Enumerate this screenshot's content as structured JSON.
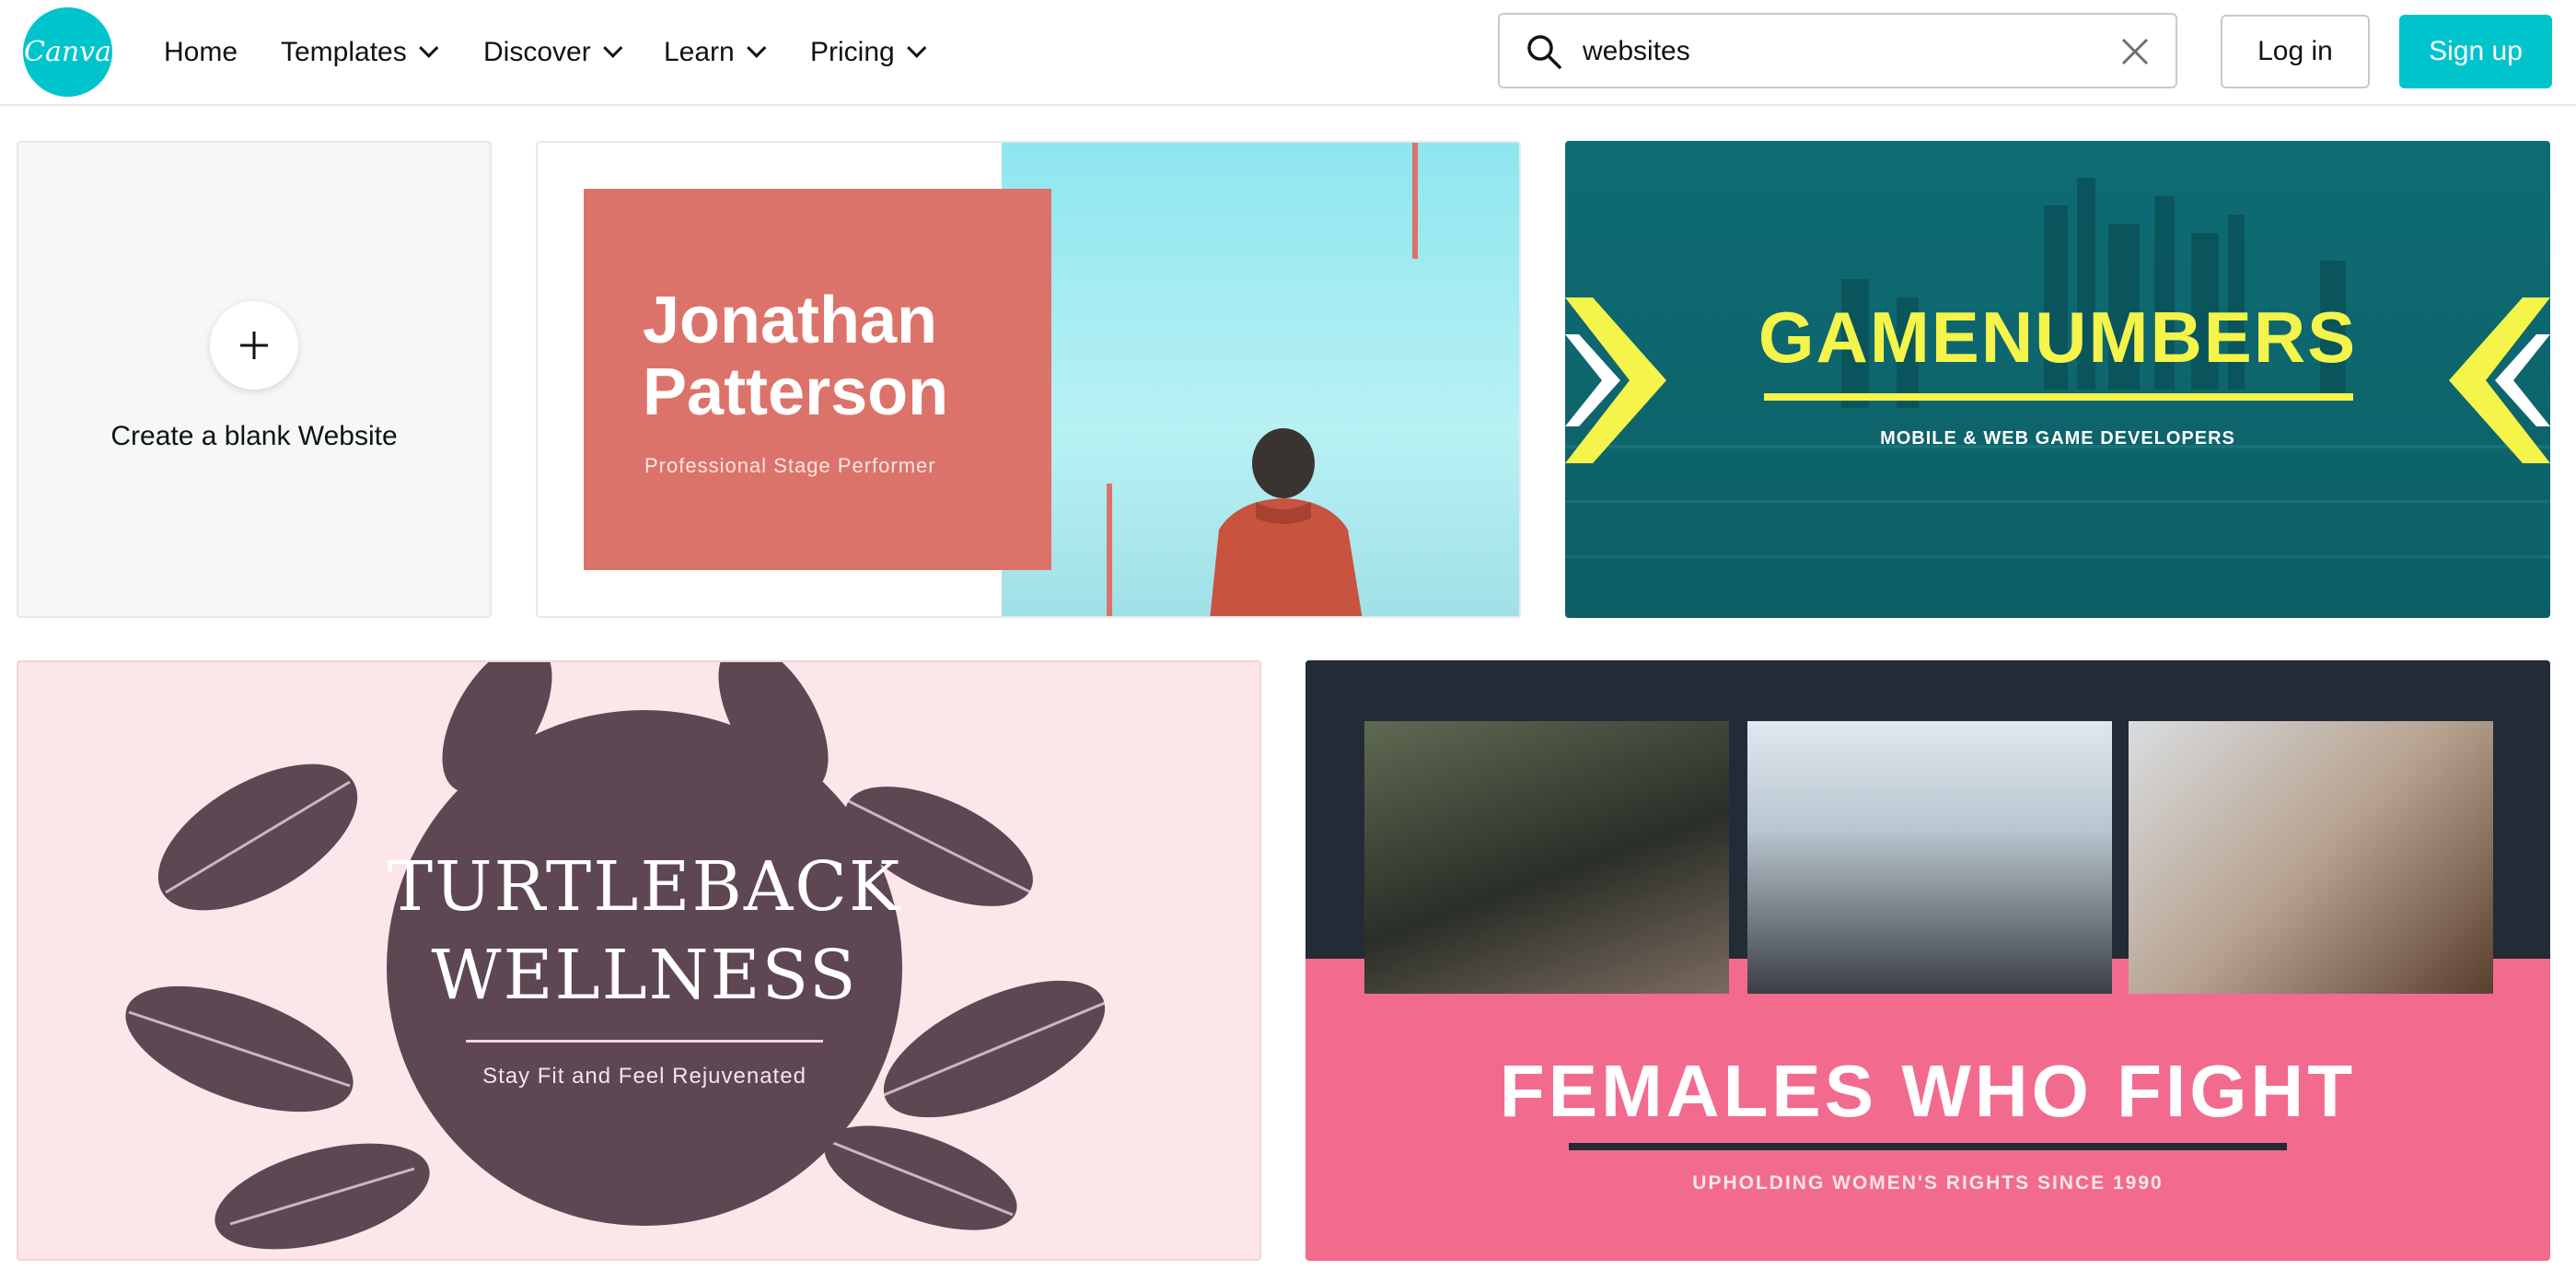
{
  "header": {
    "logo_text": "Canva",
    "nav": [
      {
        "label": "Home",
        "has_dropdown": false
      },
      {
        "label": "Templates",
        "has_dropdown": true
      },
      {
        "label": "Discover",
        "has_dropdown": true
      },
      {
        "label": "Learn",
        "has_dropdown": true
      },
      {
        "label": "Pricing",
        "has_dropdown": true
      }
    ],
    "search": {
      "value": "websites"
    },
    "login_label": "Log in",
    "signup_label": "Sign up",
    "accent_color": "#00c4cc"
  },
  "cards": {
    "blank": {
      "label": "Create a blank Website"
    },
    "jonathan": {
      "name": "Jonathan Patterson",
      "subtitle": "Professional Stage Performer",
      "color": "#dc736a"
    },
    "game": {
      "title": "GAMENUMBERS",
      "subtitle": "MOBILE & WEB GAME DEVELOPERS",
      "color": "#f4f44a"
    },
    "turtle": {
      "title_line1": "TURTLEBACK",
      "title_line2": "WELLNESS",
      "subtitle": "Stay Fit and Feel Rejuvenated",
      "color": "#5e4653"
    },
    "females": {
      "title": "FEMALES WHO FIGHT",
      "subtitle": "UPHOLDING WOMEN'S RIGHTS SINCE 1990",
      "color": "#f26b8e"
    }
  }
}
